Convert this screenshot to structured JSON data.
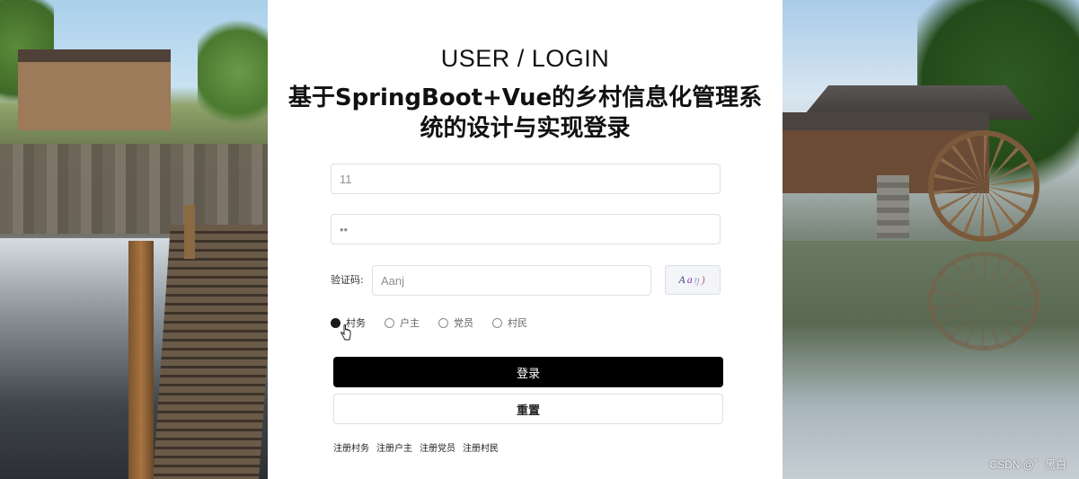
{
  "header": {
    "title_en": "USER / LOGIN",
    "title_cn": "基于SpringBoot+Vue的乡村信息化管理系统的设计与实现登录"
  },
  "form": {
    "username_value": "11",
    "password_value": "••",
    "captcha_label": "验证码:",
    "captcha_value": "Aanj",
    "captcha_image_chars": [
      "A",
      "a",
      "ŋ",
      ")"
    ]
  },
  "roles": [
    {
      "label": "村务",
      "checked": true
    },
    {
      "label": "户主",
      "checked": false
    },
    {
      "label": "党员",
      "checked": false
    },
    {
      "label": "村民",
      "checked": false
    }
  ],
  "buttons": {
    "login_label": "登录",
    "reset_label": "重置"
  },
  "register_links": [
    "注册村务",
    "注册户主",
    "注册党员",
    "注册村民"
  ],
  "watermark": "CSDN @゛黑白",
  "colors": {
    "login_button_bg": "#000000",
    "panel_bg": "#ffffff",
    "radio_checked": "#1a1a1a"
  }
}
